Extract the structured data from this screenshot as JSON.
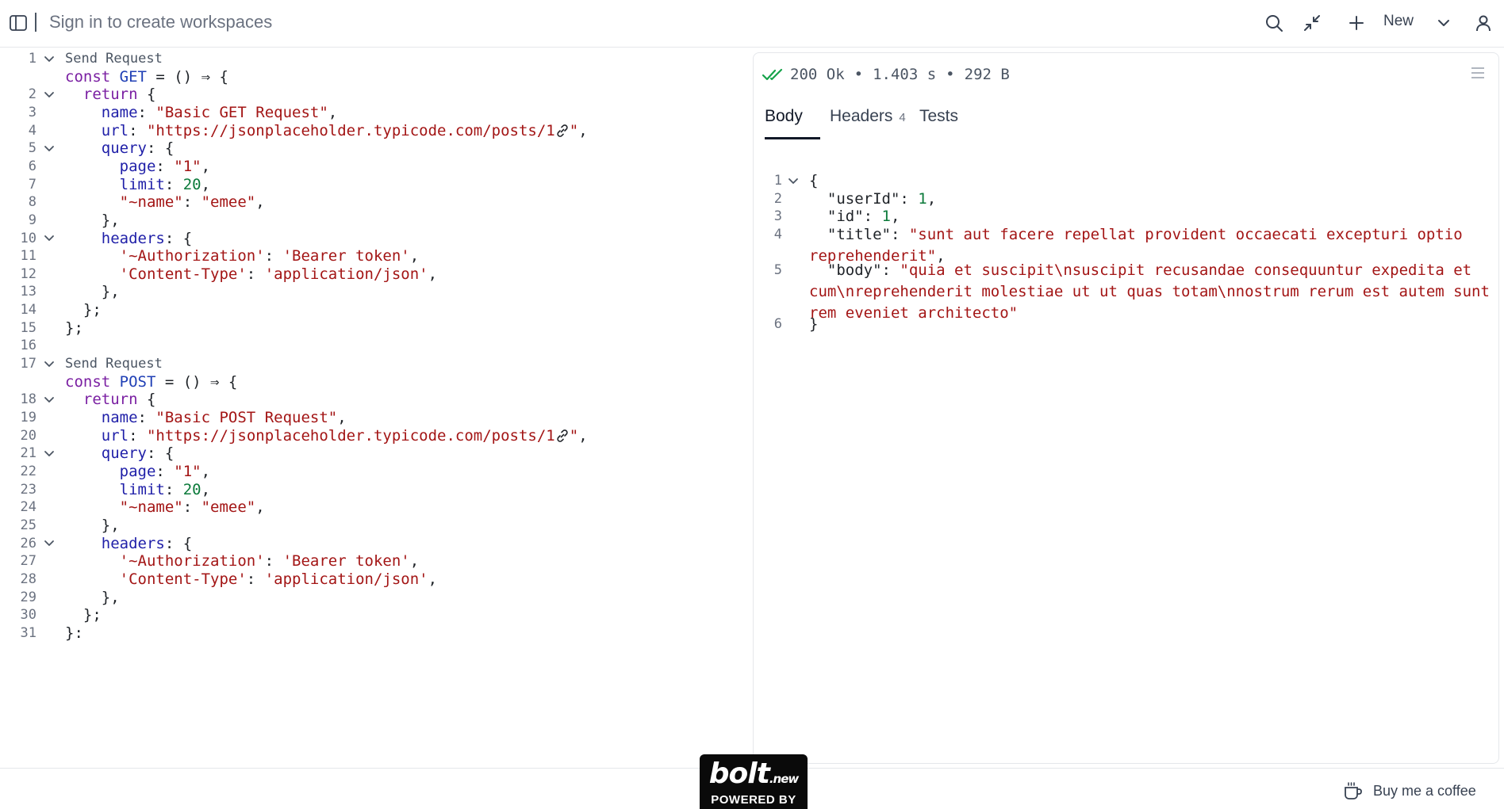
{
  "topbar": {
    "title": "Sign in to create workspaces",
    "new_label": "New",
    "icons": [
      "sidebar-toggle-icon",
      "search-icon",
      "collapse-icon",
      "plus-icon",
      "chevron-down-icon",
      "user-icon"
    ]
  },
  "editor": {
    "codelens_label": "Send Request",
    "blocks": [
      {
        "codelens_line": "1",
        "const_line": "",
        "fn_name": "GET",
        "name_value": "\"Basic GET Request\"",
        "url_value": "\"https://jsonplaceholder.typicode.com/posts/1",
        "line_numbers": [
          "2",
          "3",
          "4",
          "5",
          "6",
          "7",
          "8",
          "9",
          "10",
          "11",
          "12",
          "13",
          "14",
          "15"
        ]
      },
      {
        "codelens_line": "17",
        "const_line": "",
        "fn_name": "POST",
        "name_value": "\"Basic POST Request\"",
        "url_value": "\"https://jsonplaceholder.typicode.com/posts/1",
        "line_numbers": [
          "18",
          "19",
          "20",
          "21",
          "22",
          "23",
          "24",
          "25",
          "26",
          "27",
          "28",
          "29",
          "30",
          "31"
        ]
      }
    ],
    "empty_line": "16",
    "tokens": {
      "const": "const",
      "assign": " = () ⇒ {",
      "return": "return",
      "open": " {",
      "name_key": "name",
      "url_key": "url",
      "query_key": "query",
      "page_key": "page",
      "page_val": "\"1\"",
      "limit_key": "limit",
      "limit_val": "20",
      "tilde_name_key": "\"~name\"",
      "tilde_name_val": "\"emee\"",
      "headers_key": "headers",
      "auth_key": "'~Authorization'",
      "auth_val": "'Bearer token'",
      "ct_key": "'Content-Type'",
      "ct_val": "'application/json'",
      "close_obj": "},",
      "close_ret": "};",
      "close_fn": "};",
      "close_fn_last": "}:",
      "quote_comma": "\","
    }
  },
  "response": {
    "status_code": "200 Ok",
    "time": "1.403 s",
    "size": "292 B",
    "sep": "•",
    "status_color": "#16a34a",
    "tabs": [
      {
        "label": "Body",
        "badge": ""
      },
      {
        "label": "Headers",
        "badge": "4"
      },
      {
        "label": "Tests",
        "badge": ""
      }
    ],
    "json_lines": [
      {
        "num": "1",
        "text": "{"
      },
      {
        "num": "2",
        "key": "\"userId\"",
        "val": "1",
        "tail": ","
      },
      {
        "num": "3",
        "key": "\"id\"",
        "val": "1",
        "tail": ","
      },
      {
        "num": "4",
        "key": "\"title\"",
        "val": "\"sunt aut facere repellat provident occaecati excepturi optio reprehenderit\"",
        "tail": ","
      },
      {
        "num": "5",
        "key": "\"body\"",
        "val": "\"quia et suscipit\\nsuscipit recusandae consequuntur expedita et cum\\nreprehenderit molestiae ut ut quas totam\\nnostrum rerum est autem sunt rem eveniet architecto\"",
        "tail": ""
      },
      {
        "num": "6",
        "text": "}"
      }
    ]
  },
  "footer": {
    "bolt_logo": "bolt",
    "bolt_suffix": ".new",
    "powered_by": "POWERED BY",
    "coffee_label": "Buy me a coffee"
  }
}
